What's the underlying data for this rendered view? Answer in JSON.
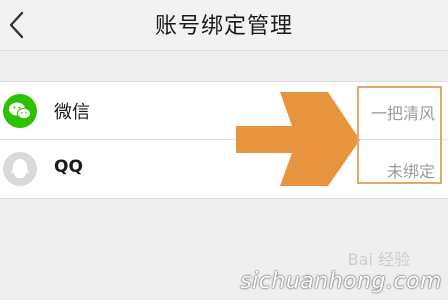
{
  "header": {
    "title": "账号绑定管理",
    "back_icon": "chevron-left-icon"
  },
  "accounts": [
    {
      "name": "微信",
      "value": "一把清风",
      "icon": "wechat-icon",
      "icon_color": "#2dc100"
    },
    {
      "name": "QQ",
      "value": "未绑定",
      "icon": "qq-icon",
      "icon_color": "#d9d9d9"
    }
  ],
  "overlay": {
    "arrow_color": "#e8943f",
    "box_color": "#e8a66b",
    "watermark": "sichuanhong.com",
    "baidu_mark": "Bai 经验"
  }
}
